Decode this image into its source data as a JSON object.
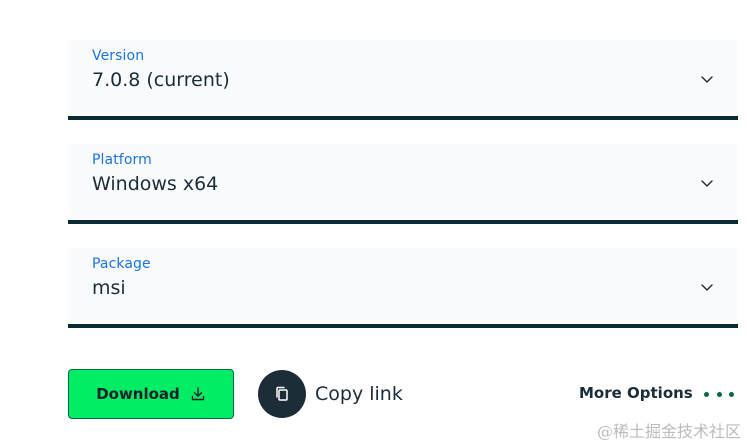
{
  "fields": {
    "version": {
      "label": "Version",
      "value": "7.0.8 (current)",
      "icon": "chevron-down-icon"
    },
    "platform": {
      "label": "Platform",
      "value": "Windows x64",
      "icon": "chevron-down-icon"
    },
    "package": {
      "label": "Package",
      "value": "msi",
      "icon": "chevron-down-icon"
    }
  },
  "actions": {
    "download_label": "Download",
    "download_icon": "download-icon",
    "copy_link_label": "Copy link",
    "copy_icon": "copy-icon",
    "more_options_label": "More Options",
    "ellipsis_icon": "ellipsis-icon"
  },
  "watermark": "@稀土掘金技术社区",
  "colors": {
    "accent_green": "#00ed64",
    "dark_green": "#00684a",
    "label_blue": "#1a73e8",
    "underline_dark": "#0b2a36",
    "field_bg": "#f9fbfc",
    "text_dark": "#1c2d38"
  }
}
